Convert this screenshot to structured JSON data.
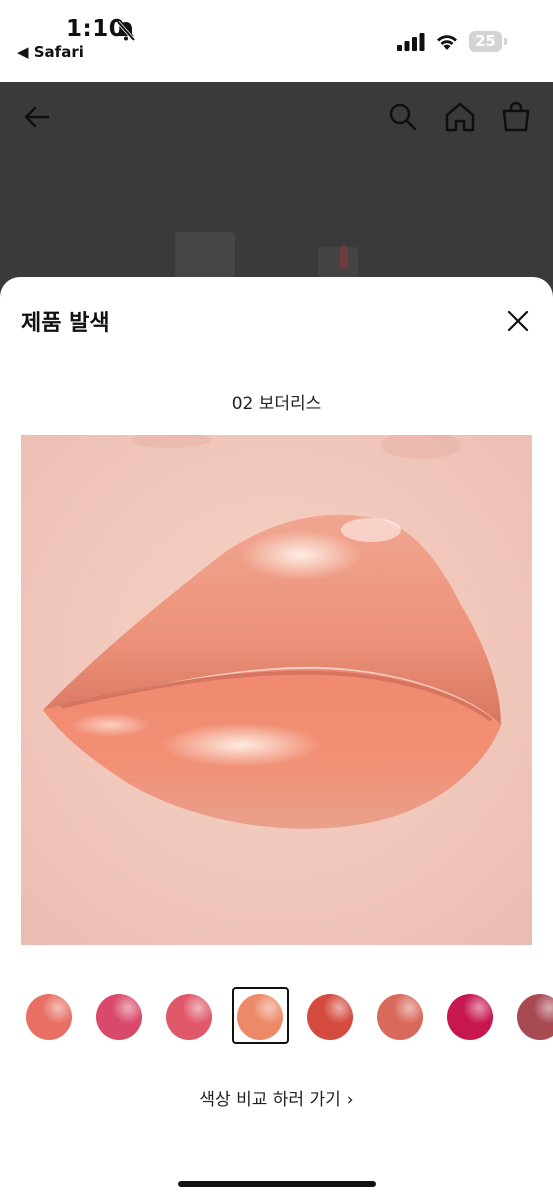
{
  "status_bar": {
    "time": "1:10",
    "back_app_label": "◀ Safari",
    "battery_level": "25"
  },
  "header_icons": [
    "back-arrow-icon",
    "search-icon",
    "home-icon",
    "shopping-bag-icon"
  ],
  "sheet": {
    "title": "제품 발색",
    "shade_name": "02 보더리스",
    "compare_link_label": "색상 비교 하러 가기",
    "compare_chevron": "›"
  },
  "color_chips": [
    {
      "color": "#e86f64",
      "selected": false
    },
    {
      "color": "#d94a6a",
      "selected": false
    },
    {
      "color": "#e0596a",
      "selected": false
    },
    {
      "color": "#ec8a68",
      "selected": true
    },
    {
      "color": "#d44a3e",
      "selected": false
    },
    {
      "color": "#d9695a",
      "selected": false
    },
    {
      "color": "#c8174f",
      "selected": false
    },
    {
      "color": "#a84a52",
      "selected": false
    }
  ]
}
